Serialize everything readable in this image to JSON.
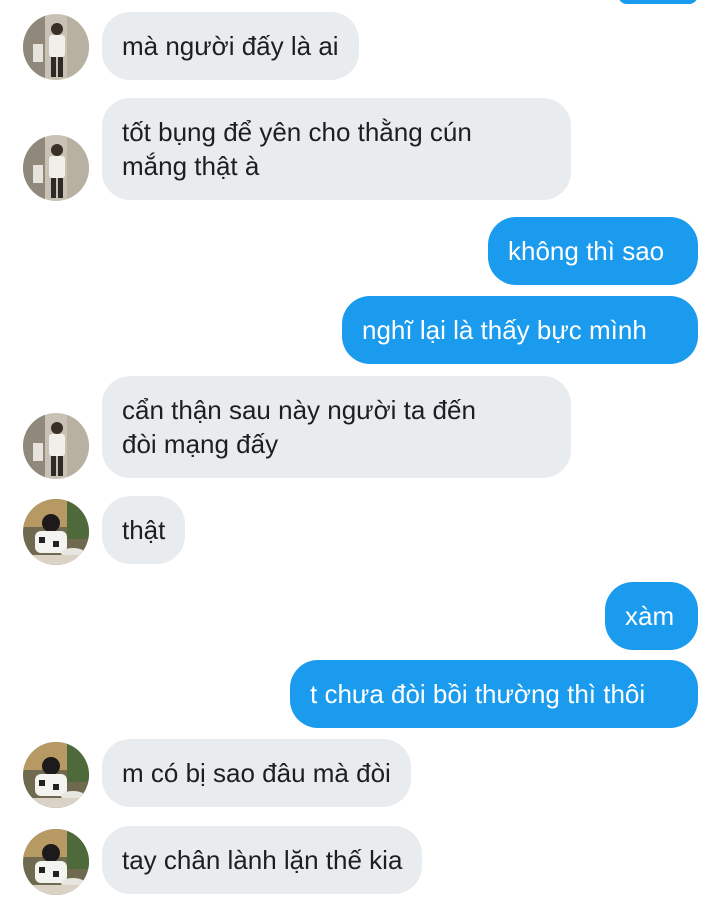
{
  "colors": {
    "outgoing_bubble": "#1a9bee",
    "incoming_bubble": "#e9ecef",
    "incoming_text": "#1c1e21",
    "outgoing_text": "#ffffff"
  },
  "avatars": {
    "contact_a": "avatar-standing-person-icon",
    "contact_b": "avatar-seated-person-icon"
  },
  "messages": [
    {
      "direction": "in",
      "avatar": "contact_a",
      "text": "mà người đấy là ai"
    },
    {
      "direction": "in",
      "avatar": "contact_a",
      "text": "tốt bụng để yên cho thằng cún\nmắng thật à"
    },
    {
      "direction": "out",
      "text": "không thì sao"
    },
    {
      "direction": "out",
      "text": "nghĩ lại là thấy bực mình"
    },
    {
      "direction": "in",
      "avatar": "contact_a",
      "text": "cẩn thận sau này người ta đến\nđòi mạng đấy"
    },
    {
      "direction": "in",
      "avatar": "contact_b",
      "text": "thật"
    },
    {
      "direction": "out",
      "text": "xàm"
    },
    {
      "direction": "out",
      "text": "t chưa đòi bồi thường thì thôi"
    },
    {
      "direction": "in",
      "avatar": "contact_b",
      "text": "m có bị sao đâu mà đòi"
    },
    {
      "direction": "in",
      "avatar": "contact_b",
      "text": "tay chân lành lặn thế kia"
    }
  ]
}
